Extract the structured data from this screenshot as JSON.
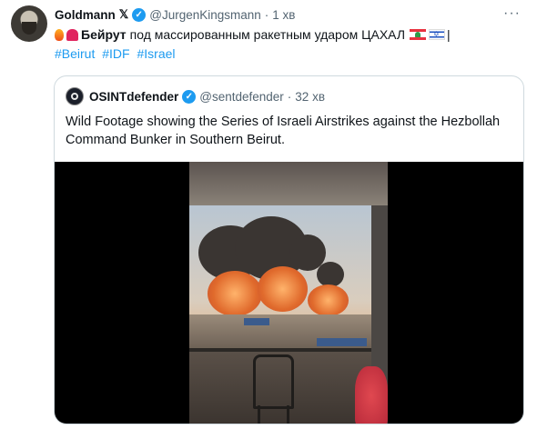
{
  "tweet": {
    "author_name": "Goldmann",
    "x_badge": "𝕏",
    "handle": "@JurgenKingsmann",
    "separator": "·",
    "time": "1 хв",
    "more": "···",
    "text_bold": "Бейрут",
    "text_rest": "под массированным ракетным ударом ЦАХАЛ",
    "cursor": "|",
    "hashtags": [
      "#Beirut",
      "#IDF",
      "#Israel"
    ]
  },
  "quote": {
    "author_name": "OSINTdefender",
    "handle": "@sentdefender",
    "separator": "·",
    "time": "32 хв",
    "text": "Wild Footage showing the Series of Israeli Airstrikes against the Hezbollah Command Bunker in Southern Beirut."
  },
  "colors": {
    "link": "#1d9bf0",
    "verified": "#1d9bf0",
    "secondary_text": "#536471",
    "border": "#cfd9de"
  },
  "icons": [
    "fire-icon",
    "siren-icon",
    "lebanon-flag-icon",
    "israel-flag-icon",
    "verified-badge-icon",
    "more-options-icon"
  ]
}
